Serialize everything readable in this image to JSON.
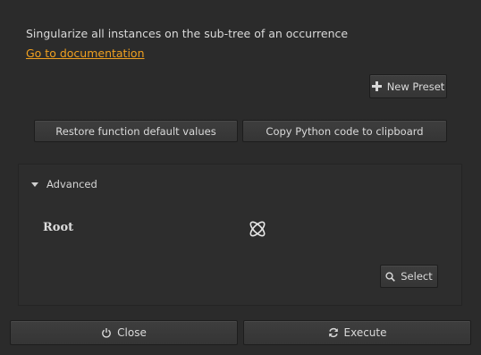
{
  "description": "Singularize all instances on the sub-tree of an occurrence",
  "doc_link": "Go to documentation",
  "buttons": {
    "new_preset": "New Preset",
    "restore_defaults": "Restore function default values",
    "copy_python": "Copy Python code to clipboard",
    "select": "Select",
    "close": "Close",
    "execute": "Execute"
  },
  "advanced": {
    "label": "Advanced",
    "expanded": true,
    "root_label": "Root",
    "root_icon": "assembly-icon"
  },
  "colors": {
    "background": "#2b2b2b",
    "link": "#f0a020",
    "text": "#d6d6d6"
  }
}
